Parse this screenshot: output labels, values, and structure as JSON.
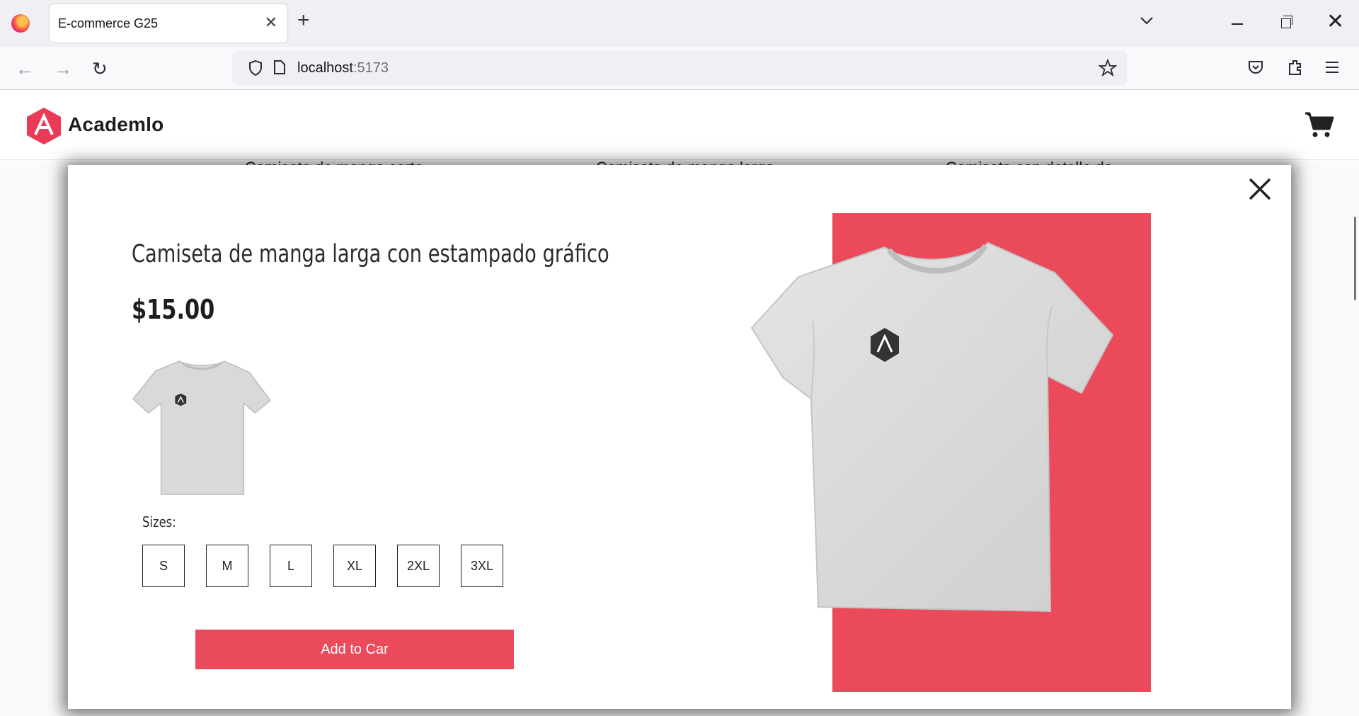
{
  "browser": {
    "tab_title": "E-commerce G25",
    "url_host": "localhost",
    "url_port": ":5173"
  },
  "site": {
    "brand": "Academlo",
    "background_products": [
      "Camiseta de manga corta",
      "Camiseta de manga larga",
      "Camiseta con detalle de"
    ]
  },
  "modal": {
    "title": "Camiseta de manga larga con estampado gráfico",
    "price": "$15.00",
    "sizes_label": "Sizes:",
    "sizes": [
      "S",
      "M",
      "L",
      "XL",
      "2XL",
      "3XL"
    ],
    "add_button": "Add to Car"
  },
  "colors": {
    "accent": "#ea4a5a",
    "shirt": "#dcdcdc"
  },
  "icons": [
    "firefox-icon",
    "close-icon",
    "plus-icon",
    "chevron-down-icon",
    "back-icon",
    "forward-icon",
    "reload-icon",
    "shield-icon",
    "page-icon",
    "star-icon",
    "pocket-icon",
    "extensions-icon",
    "menu-icon",
    "academlo-logo-icon",
    "cart-icon"
  ]
}
